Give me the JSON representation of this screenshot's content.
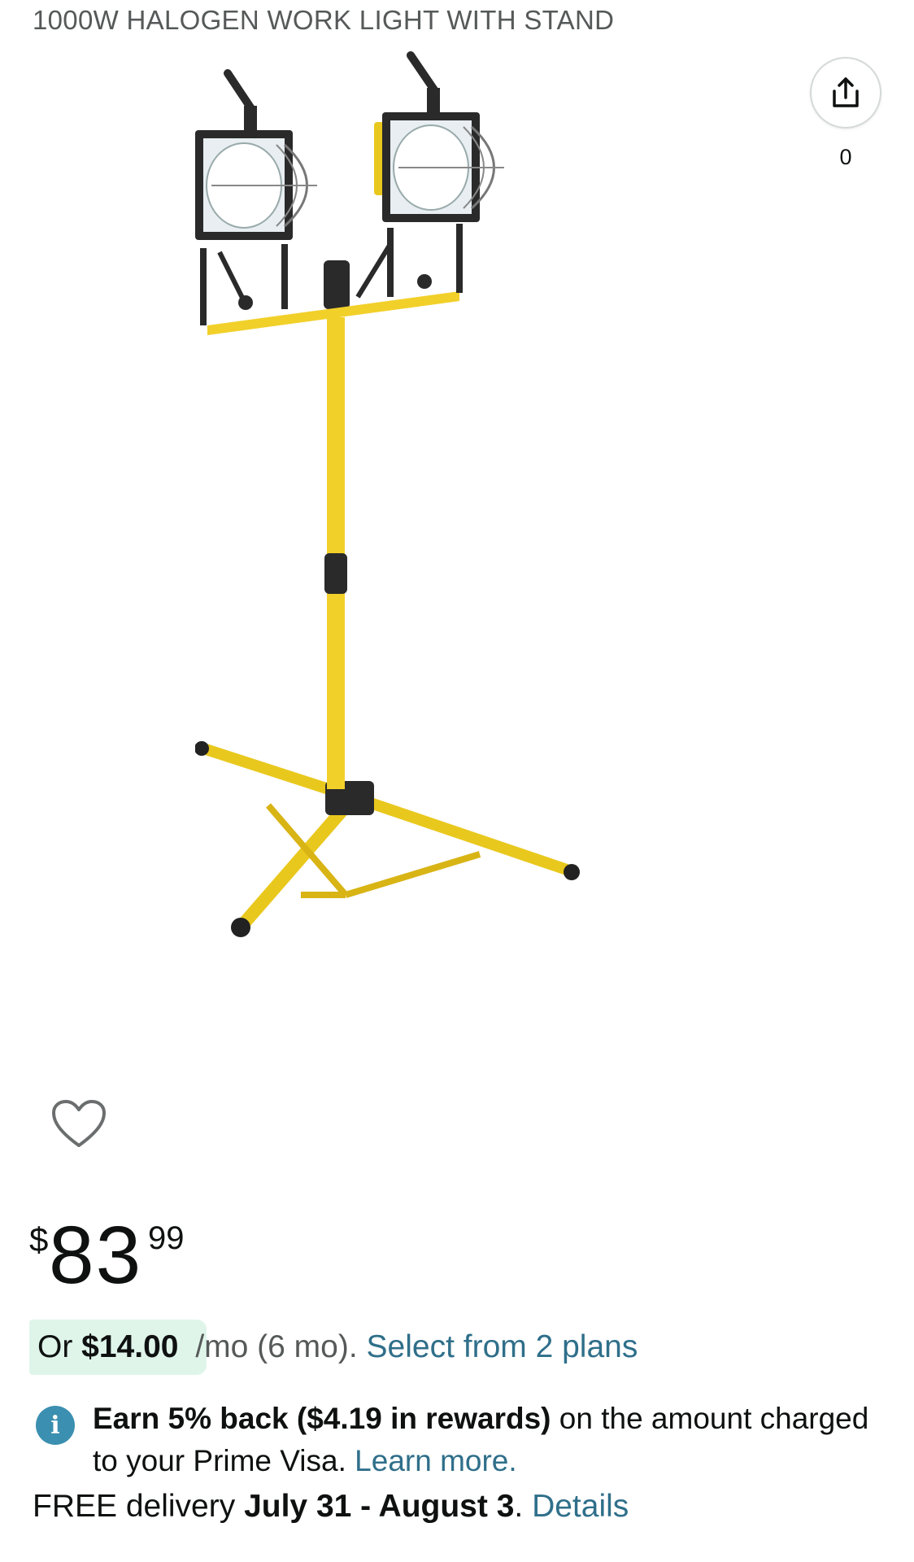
{
  "product": {
    "title": "1000W HALOGEN WORK LIGHT WITH STAND",
    "image_icon": "halogen-work-light-image"
  },
  "share": {
    "icon": "share-icon",
    "count": "0"
  },
  "wishlist": {
    "icon": "heart-icon"
  },
  "price": {
    "symbol": "$",
    "whole": "83",
    "fraction": "99"
  },
  "installment": {
    "prefix": "Or",
    "amount": "$14.00",
    "suffix": "/mo (6 mo).",
    "plans_link": "Select from 2 plans",
    "highlight_color": "#dff5ea"
  },
  "rewards": {
    "icon": "info-icon",
    "bold_text": "Earn 5% back ($4.19 in rewards)",
    "text": "on the amount charged to your Prime Visa.",
    "link": "Learn more."
  },
  "delivery": {
    "prefix": "FREE delivery",
    "dates": "July 31 - August 3",
    "link": "Details"
  },
  "colors": {
    "link": "#2f6f8a",
    "info": "#3b8fb0",
    "stand_yellow": "#f2d02a"
  }
}
